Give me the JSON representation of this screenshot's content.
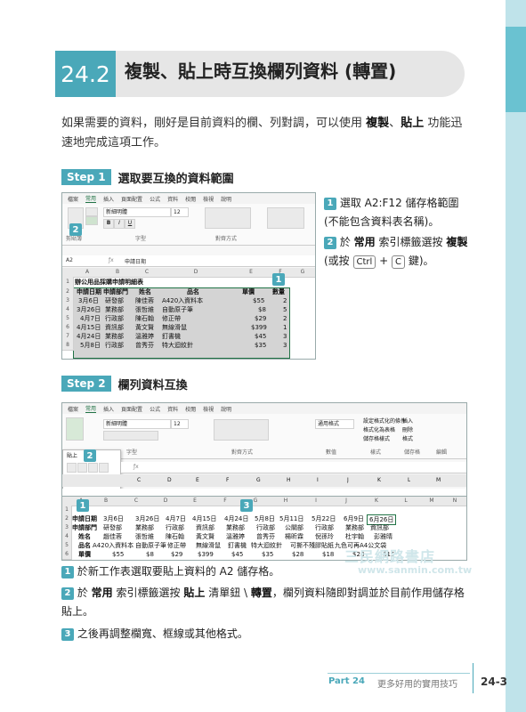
{
  "section": {
    "number": "24.2",
    "title": "複製、貼上時互換欄列資料 (轉置)"
  },
  "intro": {
    "part1": "如果需要的資料，剛好是目前資料的欄、列對調，可以使用",
    "kw1": "複製",
    "sep": "、",
    "kw2": "貼上",
    "part2": "功能迅速地完成這項工作。"
  },
  "step1": {
    "badge": "Step 1",
    "title": "選取要互換的資料範圍",
    "ribbon_tabs": [
      "檔案",
      "常用",
      "插入",
      "頁面配置",
      "公式",
      "資料",
      "校閱",
      "檢視",
      "說明"
    ],
    "font_name": "新細明體",
    "font_size": "12",
    "ribbon_groups": [
      "剪貼簿",
      "字型",
      "對齊方式"
    ],
    "name_box": "A2",
    "formula_value": "申請日期",
    "columns": [
      "A",
      "B",
      "C",
      "D",
      "E",
      "F",
      "G"
    ],
    "rows": [
      "1",
      "2",
      "3",
      "4",
      "5",
      "6",
      "7",
      "8"
    ],
    "sheet_title": "辦公用品採購申請明細表",
    "headers": [
      "申請日期",
      "申請部門",
      "姓名",
      "品名",
      "單價",
      "數量"
    ],
    "data": [
      [
        "3月6日",
        "研發部",
        "陳佳蓉",
        "A420入資料本",
        "$55",
        "2"
      ],
      [
        "3月26日",
        "業務部",
        "張哲維",
        "自動原子筆",
        "$8",
        "5"
      ],
      [
        "4月7日",
        "行政部",
        "陳石翰",
        "修正帶",
        "$29",
        "2"
      ],
      [
        "4月15日",
        "資訊部",
        "黃文賢",
        "無線滑鼠",
        "$399",
        "1"
      ],
      [
        "4月24日",
        "業務部",
        "溫雅婷",
        "釘書機",
        "$45",
        "3"
      ],
      [
        "5月8日",
        "行政部",
        "曾秀芬",
        "特大迴紋針",
        "$35",
        "3"
      ]
    ],
    "callout_1": "1",
    "callout_2": "2"
  },
  "step1_notes": {
    "n1_num": "1",
    "n1_text": "選取 A2:F12 儲存格範圍 (不能包含資料表名稱)。",
    "n2_num": "2",
    "n2_a": "於",
    "n2_kw1": "常用",
    "n2_b": "索引標籤選按",
    "n2_kw2": "複製",
    "n2_c": "(或按",
    "n2_key1": "Ctrl",
    "n2_plus": "+",
    "n2_key2": "C",
    "n2_d": "鍵)。"
  },
  "step2": {
    "badge": "Step 2",
    "title": "欄列資料互換",
    "ribbon_tabs": [
      "檔案",
      "常用",
      "插入",
      "頁面配置",
      "公式",
      "資料",
      "校閱",
      "檢視",
      "說明"
    ],
    "font_name": "新細明體",
    "font_size": "12",
    "number_format": "通用格式",
    "ribbon_groups": [
      "字型",
      "對齊方式",
      "數值",
      "樣式",
      "儲存格",
      "編輯"
    ],
    "style_items": [
      "設定格式化的條件",
      "格式化為表格",
      "儲存格樣式"
    ],
    "cell_items": [
      "插入",
      "刪除",
      "格式"
    ],
    "paste_label": "貼上",
    "columns": [
      "A",
      "B",
      "C",
      "D",
      "E",
      "F",
      "G",
      "H",
      "I",
      "J",
      "K",
      "L",
      "M",
      "N",
      "O"
    ],
    "rows": [
      "1",
      "2",
      "3",
      "4",
      "5",
      "6"
    ],
    "transposed": [
      [
        "申請日期",
        "3月6日",
        "3月26日",
        "4月7日",
        "4月15日",
        "4月24日",
        "5月8日",
        "5月11日",
        "5月22日",
        "6月9日",
        "6月26日"
      ],
      [
        "申請部門",
        "研發部",
        "業務部",
        "行政部",
        "資訊部",
        "業務部",
        "行政部",
        "公關部",
        "行政部",
        "業務部",
        "資訊部"
      ],
      [
        "姓名",
        "趙佳蓉",
        "張哲維",
        "陳石翰",
        "黃文賢",
        "溫雅婷",
        "曾秀芬",
        "楊昕霖",
        "倪孫玲",
        "杜宇翰",
        "彭雅晴"
      ],
      [
        "品名",
        "A420入資料本",
        "自動原子筆",
        "修正帶",
        "無線滑鼠",
        "釘書機",
        "特大迴紋針",
        "可撕不殘膠貼紙",
        "九色可再A4公文袋",
        "",
        ""
      ],
      [
        "單價",
        "$55",
        "$8",
        "$29",
        "$399",
        "$45",
        "$35",
        "$28",
        "$18",
        "$28",
        "$15"
      ]
    ],
    "callout_1": "1",
    "callout_2": "2",
    "callout_3": "3"
  },
  "step2_notes": {
    "n1_num": "1",
    "n1_text": "於新工作表選取要貼上資料的 A2 儲存格。",
    "n2_num": "2",
    "n2_a": "於",
    "n2_kw1": "常用",
    "n2_b": "索引標籤選按",
    "n2_kw2": "貼上",
    "n2_c": "清單鈕 \\",
    "n2_kw3": "轉置",
    "n2_d": "，欄列資料隨即對調並於目前作用儲存格貼上。",
    "n3_num": "3",
    "n3_text": "之後再調整欄寬、框線或其他格式。"
  },
  "watermark": {
    "line1": "三民網路書店",
    "line2": "www.sanmin.com.tw"
  },
  "footer": {
    "part": "Part 24",
    "subtitle": "更多好用的實用技巧",
    "page": "24-3"
  },
  "colors": {
    "accent": "#4aa8b9",
    "sidebar": "#bfe3ea",
    "excel_green": "#217346"
  }
}
